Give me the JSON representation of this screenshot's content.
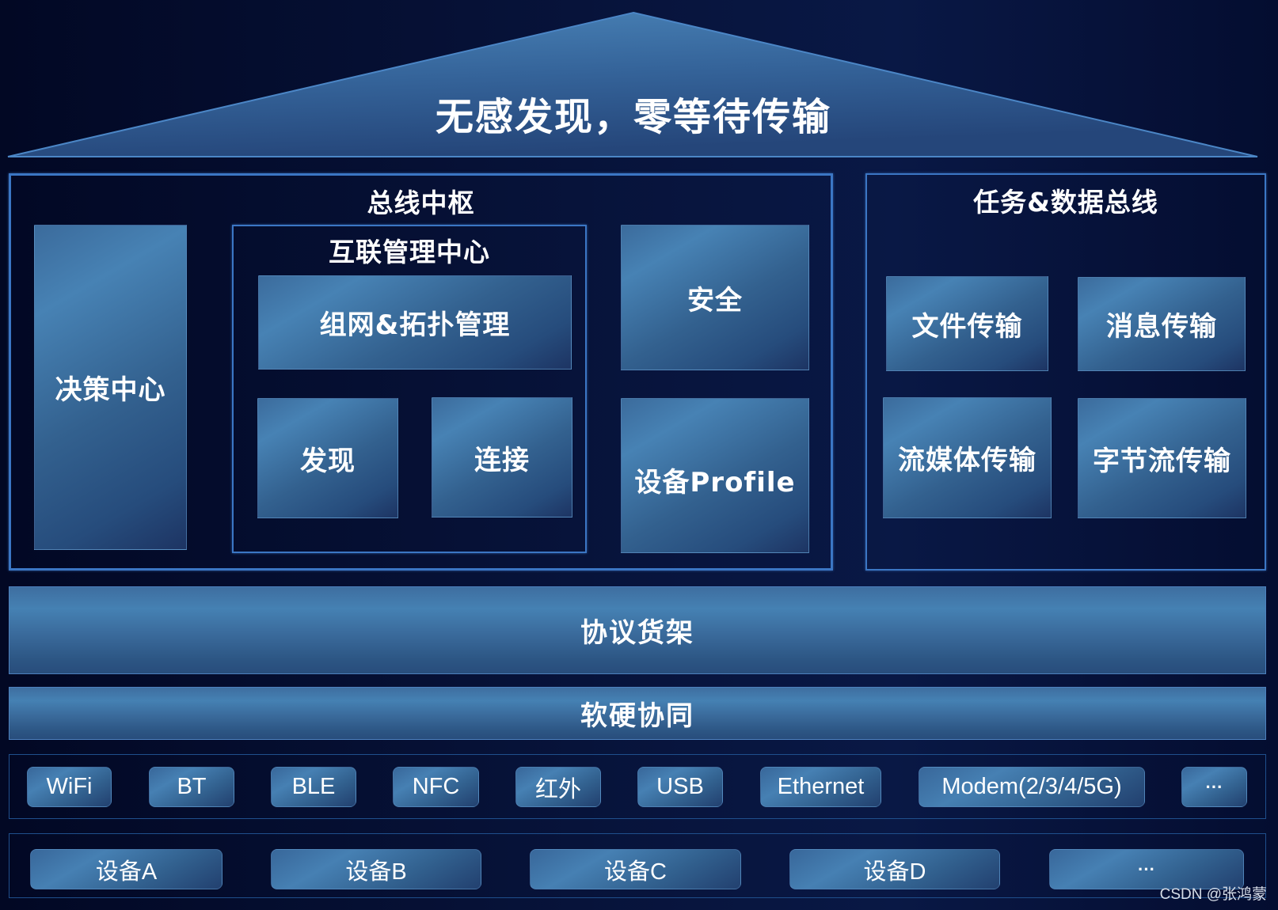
{
  "roof": {
    "title": "无感发现，零等待传输"
  },
  "bus_hub": {
    "title": "总线中枢",
    "decision_center": "决策中心",
    "interconnect": {
      "title": "互联管理中心",
      "networking": "组网&拓扑管理",
      "discovery": "发现",
      "connection": "连接"
    },
    "security": "安全",
    "device_profile": "设备Profile"
  },
  "task_bus": {
    "title": "任务&数据总线",
    "items": [
      "文件传输",
      "消息传输",
      "流媒体传输",
      "字节流传输"
    ]
  },
  "protocol_shelf": "协议货架",
  "hw_sw_coop": "软硬协同",
  "transports": [
    "WiFi",
    "BT",
    "BLE",
    "NFC",
    "红外",
    "USB",
    "Ethernet",
    "Modem(2/3/4/5G)",
    "···"
  ],
  "devices": [
    "设备A",
    "设备B",
    "设备C",
    "设备D",
    "···"
  ],
  "watermark": "CSDN @张鸿蒙",
  "colors": {
    "background": "#040b26",
    "frame_border": "#3b76c4",
    "block_light": "#4782b4",
    "block_dark": "#1d3463"
  }
}
